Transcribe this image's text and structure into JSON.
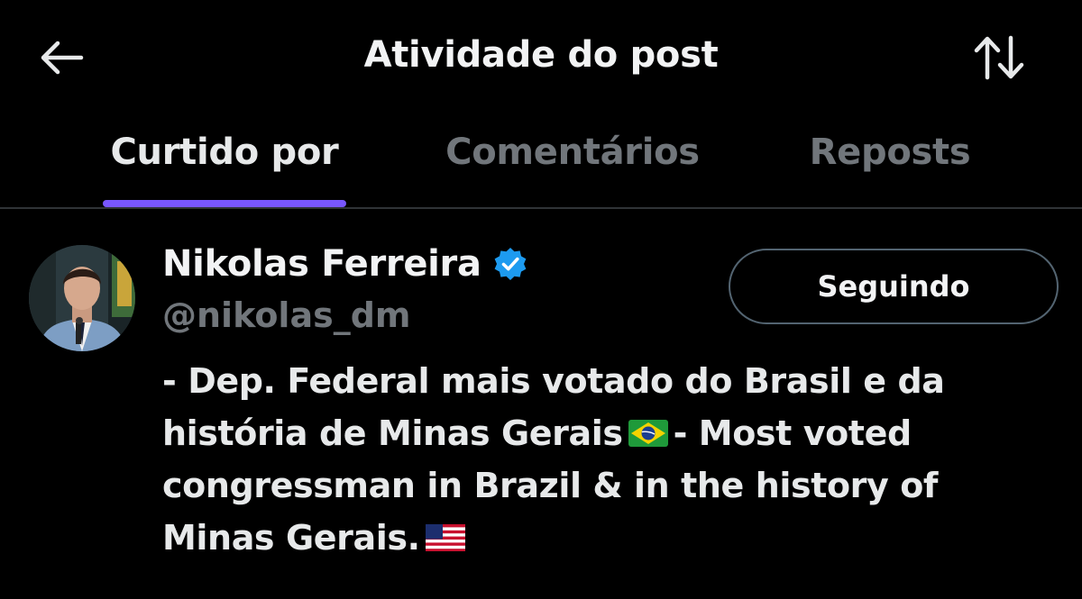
{
  "header": {
    "title": "Atividade do post",
    "back_icon": "arrow-left-icon",
    "sort_icon": "sort-arrows-icon"
  },
  "tabs": [
    {
      "label": "Curtido por",
      "active": true
    },
    {
      "label": "Comentários",
      "active": false
    },
    {
      "label": "Reposts",
      "active": false
    }
  ],
  "user": {
    "display_name": "Nikolas Ferreira",
    "verified": true,
    "handle": "@nikolas_dm",
    "follow_label": "Seguindo",
    "bio_lines": [
      "- Dep. Federal mais votado do Brasil e da",
      "história de Minas Gerais",
      "- Most voted",
      "congressman in Brazil & in the history of",
      "Minas Gerais."
    ],
    "bio_emojis": [
      "brazil-flag-icon",
      "us-flag-icon"
    ]
  },
  "colors": {
    "background": "#000000",
    "accent": "#7856ff",
    "verified": "#1d9bf0",
    "muted_text": "#71767b",
    "divider": "#2f3336"
  }
}
